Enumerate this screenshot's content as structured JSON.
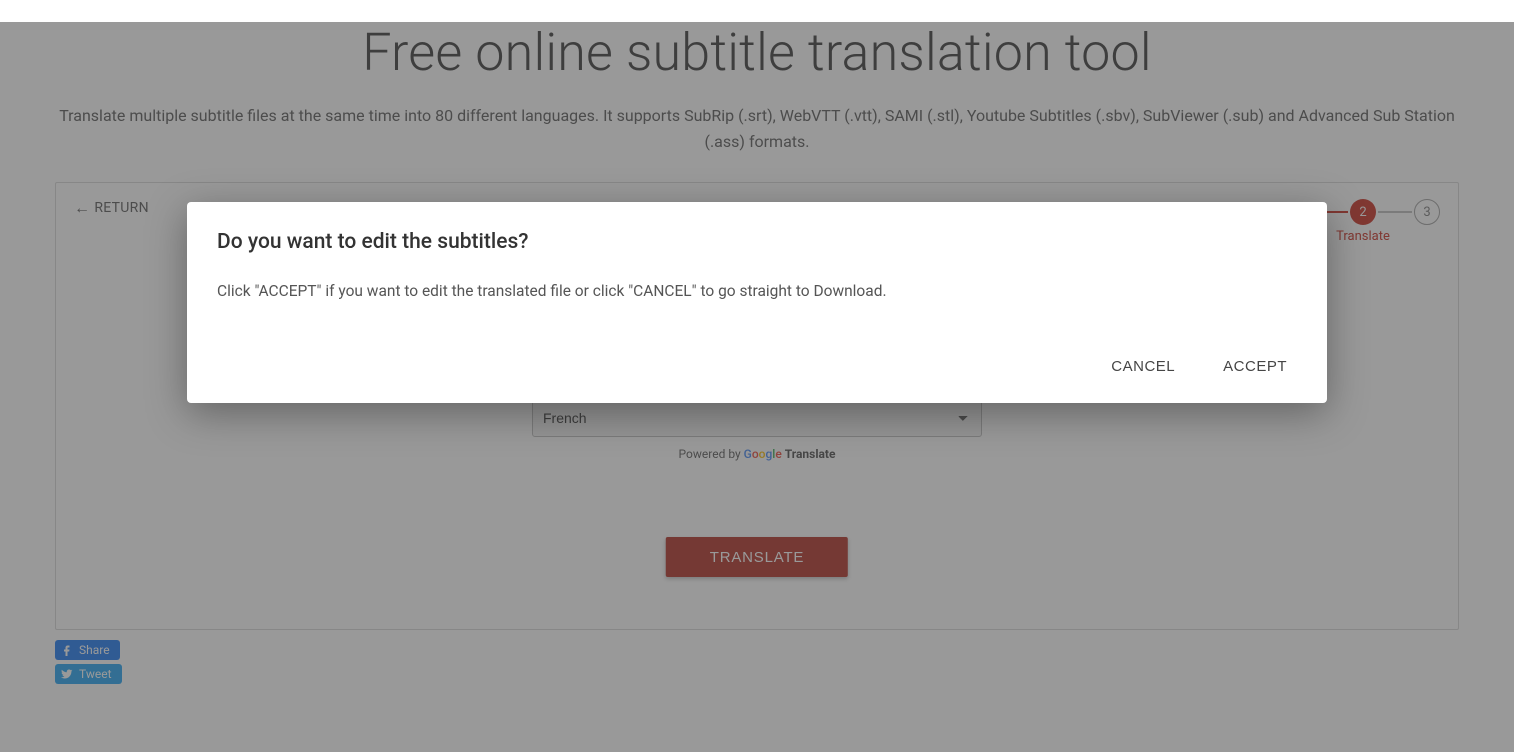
{
  "header": {
    "title": "Free online subtitle translation tool",
    "description": "Translate multiple subtitle files at the same time into 80 different languages. It supports SubRip (.srt), WebVTT (.vtt), SAMI (.stl), Youtube Subtitles (.sbv), SubViewer (.sub) and Advanced Sub Station (.ass) formats."
  },
  "card": {
    "return_label": "RETURN",
    "stepper": {
      "step2_number": "2",
      "step2_label": "Translate",
      "step3_number": "3"
    },
    "language_select_value": "French",
    "powered_prefix": "Powered by ",
    "powered_brand_word": "Translate",
    "translate_button": "TRANSLATE"
  },
  "share": {
    "facebook": "Share",
    "twitter": "Tweet"
  },
  "modal": {
    "title": "Do you want to edit the subtitles?",
    "body": "Click \"ACCEPT\" if you want to edit the translated file or click \"CANCEL\" to go straight to Download.",
    "cancel": "CANCEL",
    "accept": "ACCEPT"
  }
}
